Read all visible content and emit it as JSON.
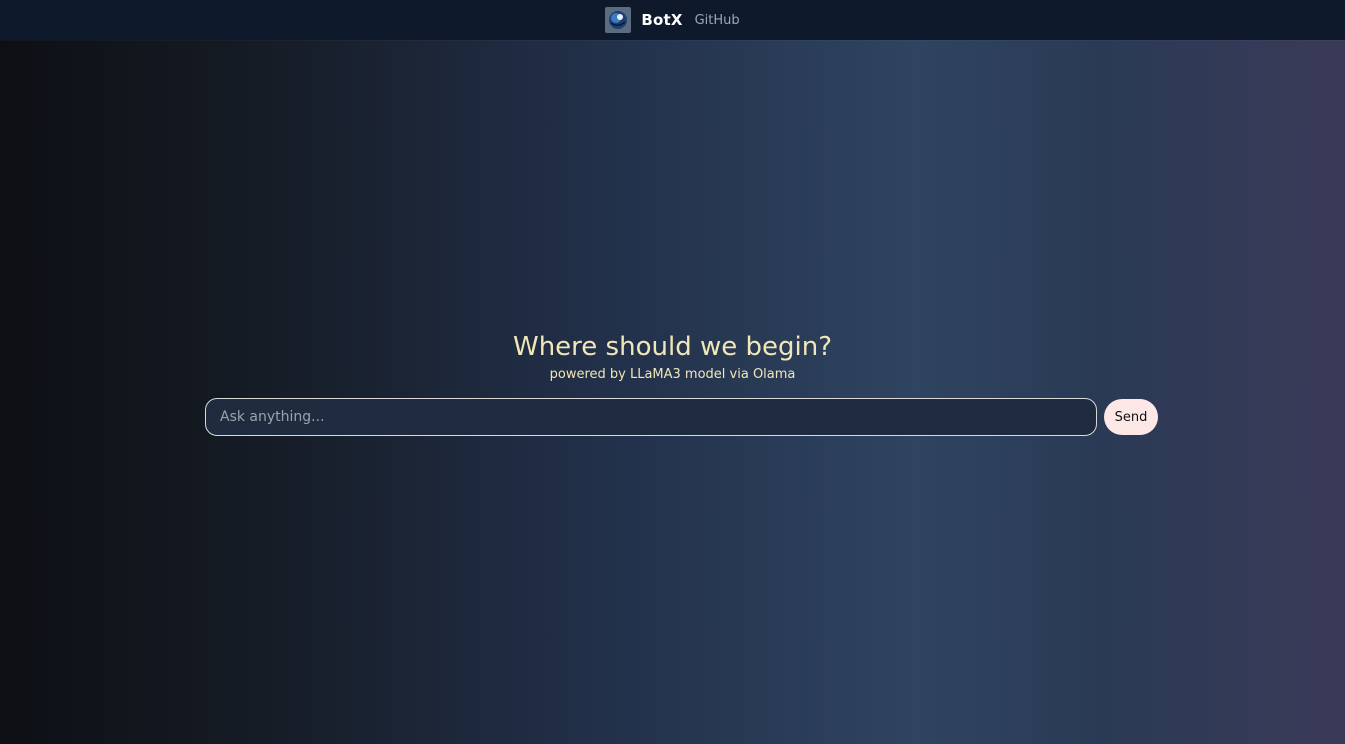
{
  "navbar": {
    "brand": "BotX",
    "github_link": "GitHub",
    "logo_icon": "globe-logo-icon"
  },
  "hero": {
    "title": "Where should we begin?",
    "subtitle": "powered by LLaMA3 model via Olama"
  },
  "chat": {
    "placeholder": "Ask anything...",
    "value": "",
    "send_label": "Send"
  },
  "colors": {
    "navbar_bg": "#0f192c",
    "title_color": "#f1e6b8",
    "send_bg": "#fde7e7"
  }
}
